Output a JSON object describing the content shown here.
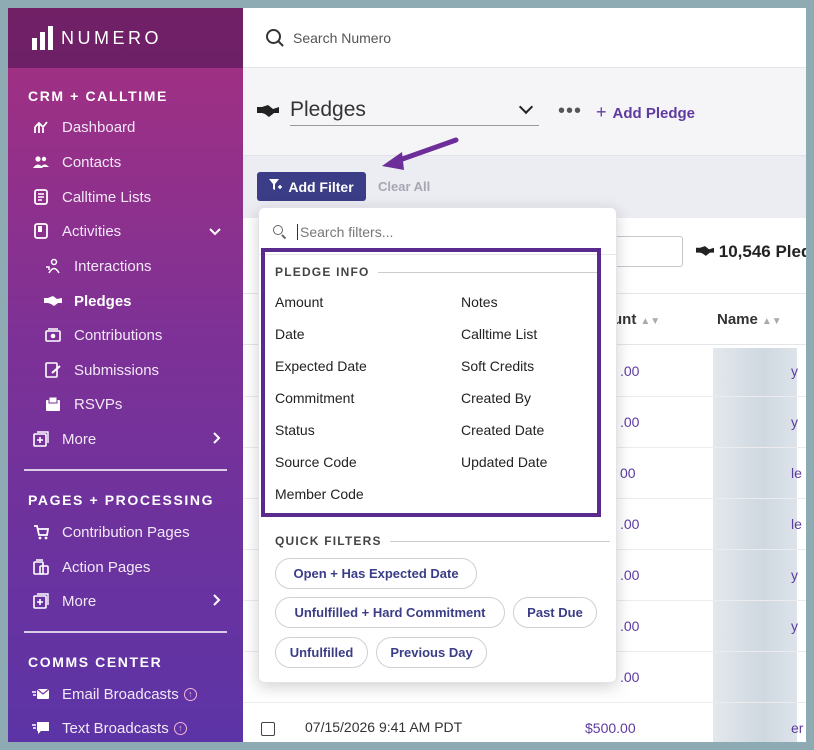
{
  "app": {
    "logo_text": "NUMERO"
  },
  "search": {
    "placeholder": "Search Numero"
  },
  "sidebar": {
    "section_crm": "CRM + CALLTIME",
    "crm_items": [
      {
        "label": "Dashboard",
        "icon": "dashboard-icon"
      },
      {
        "label": "Contacts",
        "icon": "contacts-icon"
      },
      {
        "label": "Calltime Lists",
        "icon": "calltime-lists-icon"
      },
      {
        "label": "Activities",
        "icon": "activities-icon"
      },
      {
        "label": "Interactions",
        "icon": "interactions-icon"
      },
      {
        "label": "Pledges",
        "icon": "pledges-icon"
      },
      {
        "label": "Contributions",
        "icon": "contributions-icon"
      },
      {
        "label": "Submissions",
        "icon": "submissions-icon"
      },
      {
        "label": "RSVPs",
        "icon": "rsvps-icon"
      },
      {
        "label": "More",
        "icon": "more-icon"
      }
    ],
    "section_pages": "PAGES + PROCESSING",
    "pages_items": [
      {
        "label": "Contribution Pages",
        "icon": "cart-icon"
      },
      {
        "label": "Action Pages",
        "icon": "action-pages-icon"
      },
      {
        "label": "More",
        "icon": "more-icon"
      }
    ],
    "section_comms": "COMMS CENTER",
    "comms_items": [
      {
        "label": "Email Broadcasts",
        "icon": "email-icon"
      },
      {
        "label": "Text Broadcasts",
        "icon": "text-icon"
      }
    ]
  },
  "header": {
    "title": "Pledges",
    "more": "•••",
    "add_label": "Add Pledge",
    "add_plus": "+"
  },
  "filterbar": {
    "add_filter": "Add Filter",
    "clear_all": "Clear All"
  },
  "table": {
    "count": "10,546 Pled",
    "columns": {
      "amount": "unt",
      "name": "Name"
    },
    "rows": [
      {
        "amount": ".00",
        "name": "y"
      },
      {
        "amount": ".00",
        "name": "y"
      },
      {
        "amount": "00",
        "name": "le"
      },
      {
        "amount": ".00",
        "name": "le"
      },
      {
        "amount": ".00",
        "name": "y"
      },
      {
        "amount": ".00",
        "name": "y"
      },
      {
        "amount": ".00",
        "name": ""
      },
      {
        "date": "07/15/2026 9:41 AM PDT",
        "amount": "$500.00",
        "name": "er"
      }
    ]
  },
  "dropdown": {
    "search_placeholder": "Search filters...",
    "pledge_info_title": "PLEDGE INFO",
    "pledge_info_left": [
      "Amount",
      "Date",
      "Expected Date",
      "Commitment",
      "Status",
      "Source Code",
      "Member Code"
    ],
    "pledge_info_right": [
      "Notes",
      "Calltime List",
      "Soft Credits",
      "Created By",
      "Created Date",
      "Updated Date"
    ],
    "quick_filters_title": "QUICK FILTERS",
    "quick_filters": [
      "Open + Has Expected Date",
      "Unfulfilled + Hard Commitment",
      "Past Due",
      "Unfulfilled",
      "Previous Day"
    ]
  },
  "colors": {
    "accent": "#3b3d87",
    "highlight": "#5a2a8f",
    "link": "#5e3aa0"
  }
}
